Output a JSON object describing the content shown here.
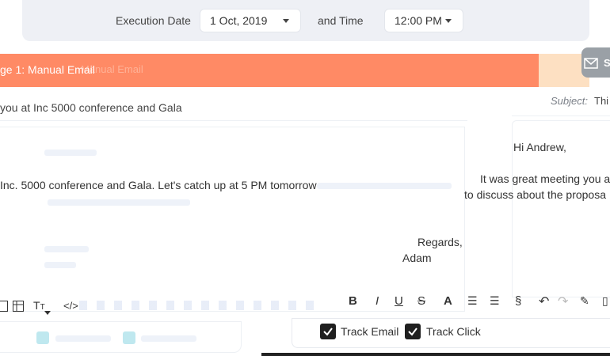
{
  "top": {
    "execution_label": "Execution Date",
    "date_value": "1 Oct, 2019",
    "and_time_label": "and Time",
    "time_value": "12:00 PM"
  },
  "stage": {
    "label": "ge 1: Manual Email",
    "ghost_label": "Manual Email",
    "send_label": "S"
  },
  "left": {
    "subject": "you at Inc 5000 conference and Gala",
    "body_line": "Inc. 5000 conference and Gala. Let's catch up at 5 PM tomorrow",
    "track_email": "Track Email",
    "track_click": "Track Click"
  },
  "right": {
    "subject_label": "Subject:",
    "subject_value": "Thi",
    "greeting": "Hi Andrew,",
    "line1": "It was great meeting you a",
    "line2": "to discuss about the proposa",
    "regards": "Regards,",
    "signature": "Adam",
    "track_email": "Track Email",
    "track_click": "Track Click"
  },
  "colors": {
    "stage_bar": "#ff8a65",
    "stage_bar_ext": "#fde0c2",
    "top_bar": "#eef0f5",
    "checkbox": "#1f1f1f"
  }
}
